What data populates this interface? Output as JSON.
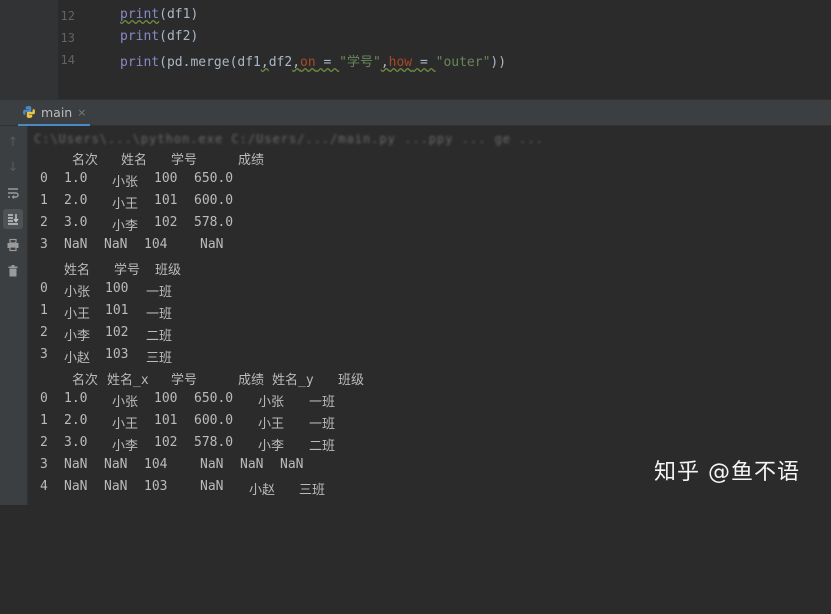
{
  "editor": {
    "lines": [
      {
        "num": "12",
        "text": "print(df1)"
      },
      {
        "num": "13",
        "text": "print(df2)"
      },
      {
        "num": "14",
        "parts": [
          "print",
          "(pd.merge(df1",
          ",",
          "df2",
          ",",
          "on",
          " = ",
          "\"学号\"",
          ",",
          "how",
          " = ",
          "\"outer\"",
          "))"
        ]
      }
    ]
  },
  "run_tab": {
    "label": "main",
    "close": "×",
    "icon": "python-icon"
  },
  "toolbar": {
    "icons": [
      "arrow-up-icon",
      "arrow-down-icon",
      "soft-wrap-icon",
      "scroll-to-end-icon",
      "print-icon",
      "trash-icon"
    ],
    "glyphs": [
      "↑",
      "↓",
      "⇌",
      "⇊",
      "⎙",
      "🗑"
    ]
  },
  "console": {
    "command_blurred": "C:\\Users\\...\\python.exe C:/Users/.../main.py                    ...ppy  ...  ge ...",
    "table1": {
      "header": [
        "名次",
        "姓名",
        "学号",
        "成绩"
      ],
      "rows": [
        [
          "0",
          "1.0",
          "小张",
          "100",
          "650.0"
        ],
        [
          "1",
          "2.0",
          "小王",
          "101",
          "600.0"
        ],
        [
          "2",
          "3.0",
          "小李",
          "102",
          "578.0"
        ],
        [
          "3",
          "NaN",
          "NaN",
          "104",
          "NaN"
        ]
      ]
    },
    "table2": {
      "header": [
        "姓名",
        "学号",
        "班级"
      ],
      "rows": [
        [
          "0",
          "小张",
          "100",
          "一班"
        ],
        [
          "1",
          "小王",
          "101",
          "一班"
        ],
        [
          "2",
          "小李",
          "102",
          "二班"
        ],
        [
          "3",
          "小赵",
          "103",
          "三班"
        ]
      ]
    },
    "table3": {
      "header": [
        "名次",
        "姓名_x",
        "学号",
        "成绩",
        "姓名_y",
        "班级"
      ],
      "rows": [
        [
          "0",
          "1.0",
          "小张",
          "100",
          "650.0",
          "小张",
          "一班"
        ],
        [
          "1",
          "2.0",
          "小王",
          "101",
          "600.0",
          "小王",
          "一班"
        ],
        [
          "2",
          "3.0",
          "小李",
          "102",
          "578.0",
          "小李",
          "二班"
        ],
        [
          "3",
          "NaN",
          "NaN",
          "104",
          "NaN",
          "NaN",
          "NaN"
        ],
        [
          "4",
          "NaN",
          "NaN",
          "103",
          "NaN",
          "小赵",
          "三班"
        ]
      ]
    }
  },
  "watermark": "知乎 @鱼不语"
}
